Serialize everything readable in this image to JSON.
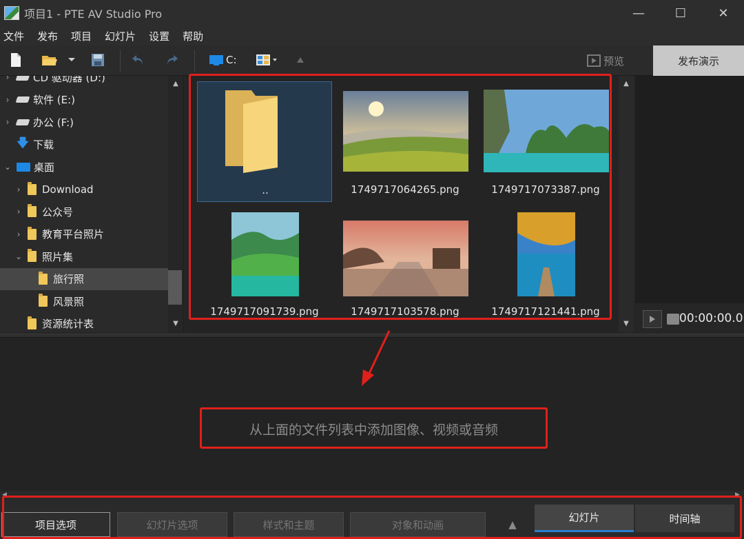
{
  "window": {
    "title": "项目1 - PTE AV Studio Pro",
    "min": "—",
    "max": "☐",
    "close": "✕"
  },
  "menu": [
    "文件",
    "发布",
    "项目",
    "幻灯片",
    "设置",
    "帮助"
  ],
  "toolbar": {
    "drive": "C:",
    "preview": "预览",
    "publish": "发布演示"
  },
  "tree": [
    {
      "label": "CD 驱动器 (D:)",
      "icon": "drive-icon",
      "indent": 0,
      "chevron": "›"
    },
    {
      "label": "软件 (E:)",
      "icon": "drive-icon",
      "indent": 0,
      "chevron": "›"
    },
    {
      "label": "办公 (F:)",
      "icon": "drive-icon",
      "indent": 0,
      "chevron": "›"
    },
    {
      "label": "下载",
      "icon": "download-icon",
      "indent": 0,
      "chevron": ""
    },
    {
      "label": "桌面",
      "icon": "desktop-icon",
      "indent": 0,
      "chevron": "⌄"
    },
    {
      "label": "Download",
      "icon": "folder-icon",
      "indent": 1,
      "chevron": "›"
    },
    {
      "label": "公众号",
      "icon": "folder-icon",
      "indent": 1,
      "chevron": "›"
    },
    {
      "label": "教育平台照片",
      "icon": "folder-icon",
      "indent": 1,
      "chevron": "›"
    },
    {
      "label": "照片集",
      "icon": "folder-icon",
      "indent": 1,
      "chevron": "⌄"
    },
    {
      "label": "旅行照",
      "icon": "folder-icon",
      "indent": 2,
      "chevron": "",
      "selected": true
    },
    {
      "label": "风景照",
      "icon": "folder-icon",
      "indent": 2,
      "chevron": ""
    },
    {
      "label": "资源统计表",
      "icon": "folder-icon",
      "indent": 1,
      "chevron": ""
    }
  ],
  "files": [
    {
      "name": "..",
      "kind": "folder"
    },
    {
      "name": "1749717064265.png",
      "kind": "image"
    },
    {
      "name": "1749717073387.png",
      "kind": "image"
    },
    {
      "name": "1749717091739.png",
      "kind": "image"
    },
    {
      "name": "1749717103578.png",
      "kind": "image"
    },
    {
      "name": "1749717121441.png",
      "kind": "image"
    }
  ],
  "player": {
    "timecode": "00:00:00.0"
  },
  "slides": {
    "hint": "从上面的文件列表中添加图像、视频或音频"
  },
  "bottom": {
    "buttons": [
      "项目选项",
      "幻灯片选项",
      "样式和主题",
      "对象和动画"
    ],
    "tabs": [
      "幻灯片",
      "时间轴"
    ]
  },
  "colors": {
    "annotation": "#e0201b",
    "active_tab_underline": "#2a7fd4",
    "folder": "#f0c75a"
  }
}
